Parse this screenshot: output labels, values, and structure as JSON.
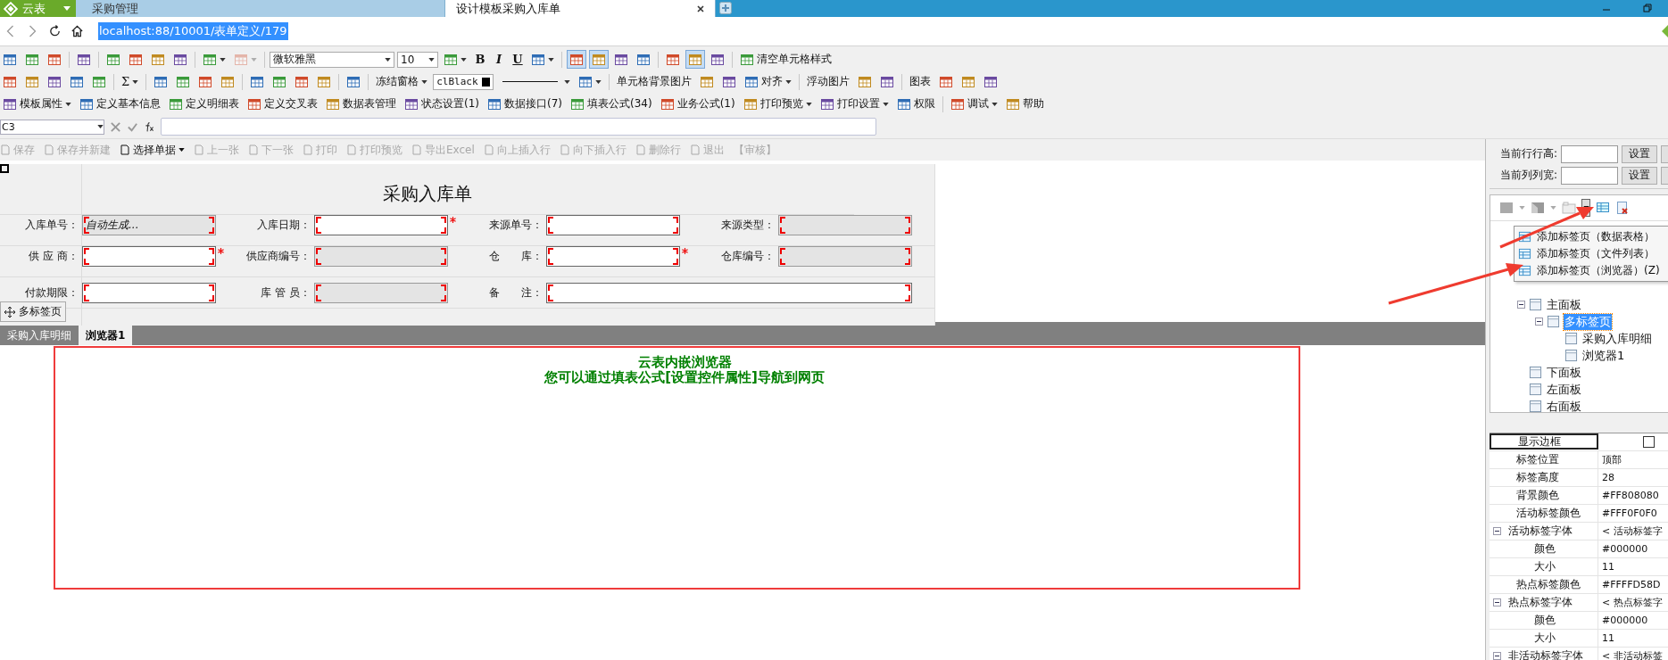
{
  "app_button": {
    "label": "云表"
  },
  "browser_tabs": [
    {
      "label": "采购管理",
      "selected": false
    },
    {
      "label": "设计模板采购入库单",
      "selected": true
    }
  ],
  "address": {
    "url": "localhost:88/10001/表单定义/179"
  },
  "toolbars": [
    {
      "items": [
        {
          "kind": "icon",
          "pressed": false
        },
        {
          "kind": "icon",
          "pressed": false
        },
        {
          "kind": "icon",
          "pressed": false
        },
        {
          "kind": "sep"
        },
        {
          "kind": "icon",
          "pressed": false
        },
        {
          "kind": "sep"
        },
        {
          "kind": "icon",
          "pressed": false
        },
        {
          "kind": "icon",
          "pressed": false
        },
        {
          "kind": "icon",
          "pressed": false
        },
        {
          "kind": "icon",
          "pressed": false
        },
        {
          "kind": "sep"
        },
        {
          "kind": "icon",
          "pressed": false,
          "dropdown": true
        },
        {
          "kind": "icon",
          "pressed": false,
          "dropdown": true,
          "disabled": true
        },
        {
          "kind": "sep"
        },
        {
          "kind": "select",
          "value": "微软雅黑"
        },
        {
          "kind": "select",
          "value": "10"
        },
        {
          "kind": "icon",
          "pressed": false,
          "dropdown": true
        },
        {
          "kind": "glyph",
          "label": "B",
          "pressed": false
        },
        {
          "kind": "glyph",
          "label": "I",
          "pressed": false
        },
        {
          "kind": "glyph",
          "label": "U",
          "pressed": false
        },
        {
          "kind": "icon",
          "pressed": false,
          "dropdown": true
        },
        {
          "kind": "sep"
        },
        {
          "kind": "icon",
          "pressed": true
        },
        {
          "kind": "icon",
          "pressed": true
        },
        {
          "kind": "icon",
          "pressed": false
        },
        {
          "kind": "icon",
          "pressed": false
        },
        {
          "kind": "sep"
        },
        {
          "kind": "icon",
          "pressed": false
        },
        {
          "kind": "icon",
          "pressed": true
        },
        {
          "kind": "icon",
          "pressed": false
        },
        {
          "kind": "sep"
        },
        {
          "kind": "label",
          "label": "清空单元格样式",
          "pressed": false
        }
      ]
    },
    {
      "items": [
        {
          "kind": "icon",
          "pressed": false
        },
        {
          "kind": "icon",
          "pressed": false
        },
        {
          "kind": "icon",
          "pressed": false
        },
        {
          "kind": "icon",
          "pressed": false
        },
        {
          "kind": "icon",
          "pressed": false
        },
        {
          "kind": "sep"
        },
        {
          "kind": "glyph",
          "label": "Σ",
          "pressed": false,
          "dropdown": true
        },
        {
          "kind": "sep"
        },
        {
          "kind": "icon",
          "pressed": false
        },
        {
          "kind": "icon",
          "pressed": false
        },
        {
          "kind": "icon",
          "pressed": false
        },
        {
          "kind": "icon",
          "pressed": false
        },
        {
          "kind": "sep"
        },
        {
          "kind": "icon",
          "pressed": false
        },
        {
          "kind": "icon",
          "pressed": false
        },
        {
          "kind": "icon",
          "pressed": false
        },
        {
          "kind": "icon",
          "pressed": false
        },
        {
          "kind": "sep"
        },
        {
          "kind": "icon",
          "pressed": false
        },
        {
          "kind": "sep"
        },
        {
          "kind": "text",
          "label": "冻结窗格",
          "pressed": false,
          "dropdown": true
        },
        {
          "kind": "color",
          "value": "clBlack",
          "color": "#000000"
        },
        {
          "kind": "line"
        },
        {
          "kind": "icon",
          "pressed": false,
          "dropdown": true
        },
        {
          "kind": "sep"
        },
        {
          "kind": "text",
          "label": "单元格背景图片",
          "pressed": false
        },
        {
          "kind": "icon",
          "pressed": false
        },
        {
          "kind": "icon",
          "pressed": false
        },
        {
          "kind": "label",
          "label": "对齐",
          "pressed": false,
          "dropdown": true
        },
        {
          "kind": "sep"
        },
        {
          "kind": "text",
          "label": "浮动图片",
          "pressed": false
        },
        {
          "kind": "icon",
          "pressed": false
        },
        {
          "kind": "icon",
          "pressed": false
        },
        {
          "kind": "sep"
        },
        {
          "kind": "text",
          "label": "图表",
          "pressed": false
        },
        {
          "kind": "icon",
          "pressed": false
        },
        {
          "kind": "icon",
          "pressed": false
        },
        {
          "kind": "icon",
          "pressed": false
        }
      ]
    },
    {
      "items": [
        {
          "kind": "label",
          "label": "模板属性",
          "pressed": false,
          "dropdown": true
        },
        {
          "kind": "label",
          "label": "定义基本信息",
          "pressed": false
        },
        {
          "kind": "label",
          "label": "定义明细表",
          "pressed": false
        },
        {
          "kind": "label",
          "label": "定义交叉表",
          "pressed": false
        },
        {
          "kind": "label",
          "label": "数据表管理",
          "pressed": false
        },
        {
          "kind": "label",
          "label": "状态设置(1)",
          "pressed": false
        },
        {
          "kind": "label",
          "label": "数据接口(7)",
          "pressed": false
        },
        {
          "kind": "label",
          "label": "填表公式(34)",
          "pressed": false
        },
        {
          "kind": "label",
          "label": "业务公式(1)",
          "pressed": false
        },
        {
          "kind": "label",
          "label": "打印预览",
          "pressed": false,
          "dropdown": true
        },
        {
          "kind": "label",
          "label": "打印设置",
          "pressed": false,
          "dropdown": true
        },
        {
          "kind": "label",
          "label": "权限",
          "pressed": false
        },
        {
          "kind": "sep"
        },
        {
          "kind": "label",
          "label": "调试",
          "pressed": false,
          "dropdown": true
        },
        {
          "kind": "label",
          "label": "帮助",
          "pressed": false
        }
      ]
    }
  ],
  "formula_bar": {
    "cell": "C3"
  },
  "actions": [
    {
      "label": "保存",
      "disabled": true
    },
    {
      "label": "保存并新建",
      "disabled": true
    },
    {
      "label": "选择单据",
      "disabled": false,
      "dropdown": true
    },
    {
      "label": "上一张",
      "disabled": true
    },
    {
      "label": "下一张",
      "disabled": true
    },
    {
      "label": "打印",
      "disabled": true
    },
    {
      "label": "打印预览",
      "disabled": true
    },
    {
      "label": "导出Excel",
      "disabled": true
    },
    {
      "label": "向上插入行",
      "disabled": true
    },
    {
      "label": "向下插入行",
      "disabled": true
    },
    {
      "label": "删除行",
      "disabled": true
    },
    {
      "label": "退出",
      "disabled": true
    },
    {
      "label": "【审核】",
      "disabled": true,
      "kind": "text"
    }
  ],
  "form": {
    "title": "采购入库单",
    "rows": [
      [
        {
          "label": "入库单号：",
          "value": "自动生成...",
          "editable": false,
          "required": false
        },
        {
          "label": "入库日期：",
          "editable": true,
          "required": true
        },
        {
          "label": "来源单号：",
          "editable": true,
          "required": false
        },
        {
          "label": "来源类型：",
          "editable": false,
          "required": false
        }
      ],
      [
        {
          "label": "供 应 商：",
          "editable": true,
          "required": true
        },
        {
          "label": "供应商编号：",
          "editable": false,
          "required": false
        },
        {
          "label": "仓　　库：",
          "editable": true,
          "required": true
        },
        {
          "label": "仓库编号：",
          "editable": false,
          "required": false
        }
      ],
      [
        {
          "label": "付款期限：",
          "editable": true,
          "required": false
        },
        {
          "label": "库 管 员：",
          "editable": false,
          "required": false
        },
        {
          "label": "备　　注：",
          "editable": true,
          "required": false
        }
      ]
    ]
  },
  "overlay_tag": {
    "label": "多标签页"
  },
  "tabs": [
    {
      "label": "采购入库明细",
      "selected": false
    },
    {
      "label": "浏览器1",
      "selected": true
    }
  ],
  "browser": {
    "lines": [
      "云表内嵌浏览器",
      "您可以通过填表公式[设置控件属性]导航到网页"
    ]
  },
  "size_controls": [
    {
      "label": "当前行行高:",
      "button": "设置"
    },
    {
      "label": "当前列列宽:",
      "button": "设置"
    }
  ],
  "tree_menu": [
    {
      "label": "添加标签页（数据表格）"
    },
    {
      "label": "添加标签页（文件列表）"
    },
    {
      "label": "添加标签页（浏览器）(Z)"
    }
  ],
  "tree": [
    {
      "label": "主面板",
      "expanded": true,
      "selected": false,
      "children": [
        {
          "label": "多标签页",
          "expanded": true,
          "selected": true,
          "children": [
            {
              "label": "采购入库明细",
              "selected": false
            },
            {
              "label": "浏览器1",
              "selected": false
            }
          ]
        }
      ]
    },
    {
      "label": "下面板",
      "selected": false
    },
    {
      "label": "左面板",
      "selected": false
    },
    {
      "label": "右面板",
      "selected": false
    }
  ],
  "properties": [
    {
      "name": "显示边框",
      "kind": "checkbox",
      "checked": false,
      "selected": true
    },
    {
      "name": "标签位置",
      "kind": "text",
      "value": "顶部",
      "selected": false
    },
    {
      "name": "标签高度",
      "kind": "text",
      "value": "28",
      "selected": false
    },
    {
      "name": "背景颜色",
      "kind": "text",
      "value": "#FF808080",
      "selected": false
    },
    {
      "name": "活动标签颜色",
      "kind": "text",
      "value": "#FFF0F0F0",
      "selected": false
    },
    {
      "name": "活动标签字体",
      "kind": "group",
      "value": "< 活动标签字",
      "expanded": true,
      "selected": false,
      "children": [
        {
          "name": "颜色",
          "kind": "text",
          "value": "#000000",
          "selected": false
        },
        {
          "name": "大小",
          "kind": "text",
          "value": "11",
          "selected": false
        }
      ]
    },
    {
      "name": "热点标签颜色",
      "kind": "text",
      "value": "#FFFFD58D",
      "selected": false
    },
    {
      "name": "热点标签字体",
      "kind": "group",
      "value": "< 热点标签字",
      "expanded": true,
      "selected": false,
      "children": [
        {
          "name": "颜色",
          "kind": "text",
          "value": "#000000",
          "selected": false
        },
        {
          "name": "大小",
          "kind": "text",
          "value": "11",
          "selected": false
        }
      ]
    },
    {
      "name": "非活动标签字体",
      "kind": "group",
      "value": "< 非活动标签",
      "expanded": true,
      "selected": false
    }
  ]
}
